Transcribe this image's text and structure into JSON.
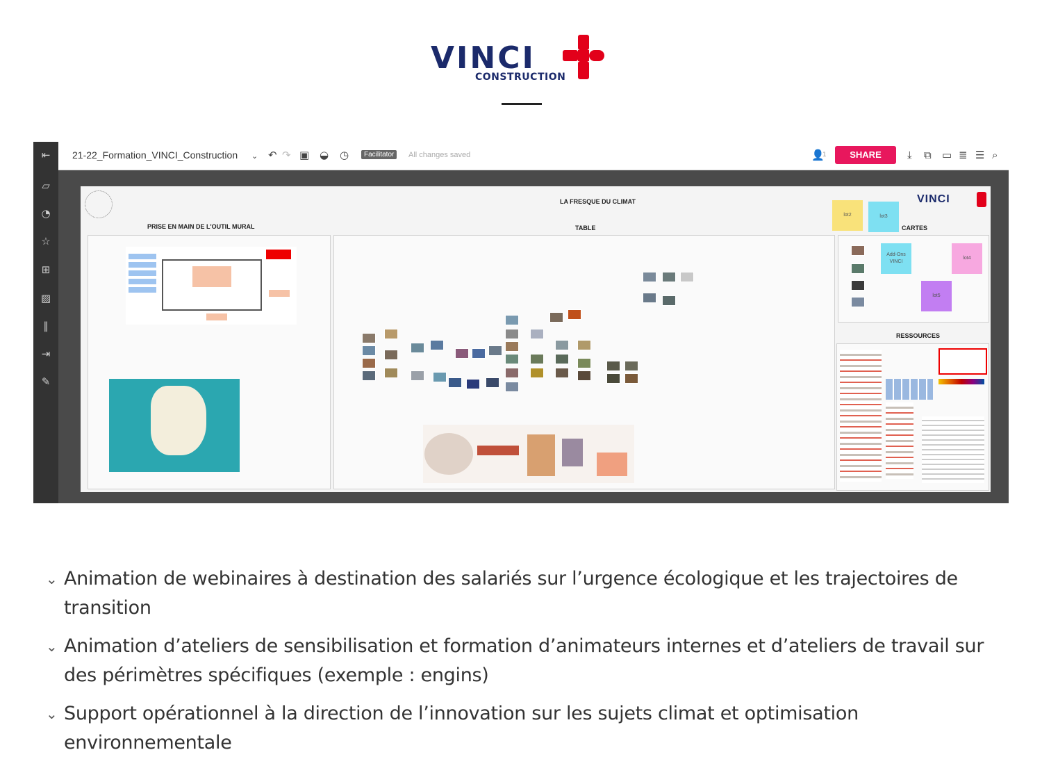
{
  "logo": {
    "word": "VINCI",
    "sub": "CONSTRUCTION",
    "brand_blue": "#1b2a6b",
    "brand_red": "#e2001a"
  },
  "app": {
    "board_title": "21-22_Formation_VINCI_Construction",
    "facilitator_label": "Facilitator",
    "saved_status": "All changes saved",
    "share_label": "SHARE",
    "share_color": "#e8175d",
    "participants": "1"
  },
  "board": {
    "frame1_label": "PRISE EN MAIN DE L'OUTIL MURAL",
    "frame2_label": "TABLE",
    "frame3_label": "CARTES",
    "frame4_label": "RESSOURCES",
    "fresque_logo": "LA FRESQUE DU CLIMAT",
    "vinci_logo": "VINCI",
    "stickies": [
      {
        "text": "lot2",
        "color": "#f9e27a"
      },
      {
        "text": "lot3",
        "color": "#7ee0f2"
      },
      {
        "text": "Add-Ons VINCI",
        "color": "#7ee0f2"
      },
      {
        "text": "lot4",
        "color": "#f7a8e0"
      },
      {
        "text": "lot5",
        "color": "#c27ef2"
      }
    ]
  },
  "bullets": [
    "Animation de webinaires à destination des salariés sur l’urgence écologique et les trajectoires de transition",
    "Animation d’ateliers de sensibilisation et formation d’animateurs internes et d’ateliers de travail sur des périmètres spécifiques (exemple : engins)",
    "Support opérationnel à la direction de l’innovation sur les sujets climat et optimisation environnementale"
  ]
}
